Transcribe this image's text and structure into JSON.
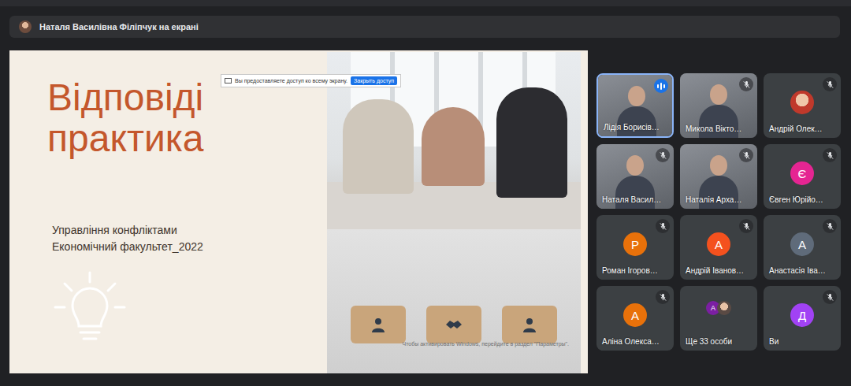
{
  "presenter_bar": {
    "text": "Наталя Василівна Філіпчук на екрані"
  },
  "slide": {
    "title_lines": [
      "Відповіді",
      "практика"
    ],
    "subtitle_lines": [
      "Управління конфліктами",
      "Економічний факультет_2022"
    ],
    "share_notice": {
      "text": "Вы предоставляете доступ ко всему экрану.",
      "button": "Закрыть доступ"
    },
    "watermark": "Чтобы активировать Windows, перейдите в раздел \"Параметры\"."
  },
  "participants": [
    {
      "name": "Лідія Борисів…",
      "kind": "video",
      "initial": "",
      "color": "#3c4043",
      "muted": false,
      "speaking": true
    },
    {
      "name": "Микола Вікто…",
      "kind": "video",
      "initial": "",
      "color": "#3c4043",
      "muted": true,
      "speaking": false
    },
    {
      "name": "Андрій Олек…",
      "kind": "photo",
      "initial": "",
      "color": "#3c4043",
      "muted": true,
      "speaking": false
    },
    {
      "name": "Наталя Васил…",
      "kind": "video",
      "initial": "",
      "color": "#3c4043",
      "muted": true,
      "speaking": false
    },
    {
      "name": "Наталія Арха…",
      "kind": "video",
      "initial": "",
      "color": "#3c4043",
      "muted": true,
      "speaking": false
    },
    {
      "name": "Євген Юрійо…",
      "kind": "letter",
      "initial": "Є",
      "color": "#e52592",
      "muted": true,
      "speaking": false
    },
    {
      "name": "Роман Ігоров…",
      "kind": "letter",
      "initial": "Р",
      "color": "#e8710a",
      "muted": true,
      "speaking": false
    },
    {
      "name": "Андрій Іванов…",
      "kind": "letter",
      "initial": "А",
      "color": "#f4511e",
      "muted": true,
      "speaking": false
    },
    {
      "name": "Анастасія Іва…",
      "kind": "letter",
      "initial": "А",
      "color": "#5f6b7a",
      "muted": true,
      "speaking": false
    },
    {
      "name": "Аліна Олекса…",
      "kind": "letter",
      "initial": "А",
      "color": "#e8710a",
      "muted": true,
      "speaking": false
    },
    {
      "name": "Ще 33 особи",
      "kind": "more",
      "initial": "А",
      "color": "#7b1fa2",
      "muted": false,
      "speaking": false
    },
    {
      "name": "Ви",
      "kind": "letter",
      "initial": "Д",
      "color": "#a142f4",
      "muted": true,
      "speaking": false
    }
  ]
}
